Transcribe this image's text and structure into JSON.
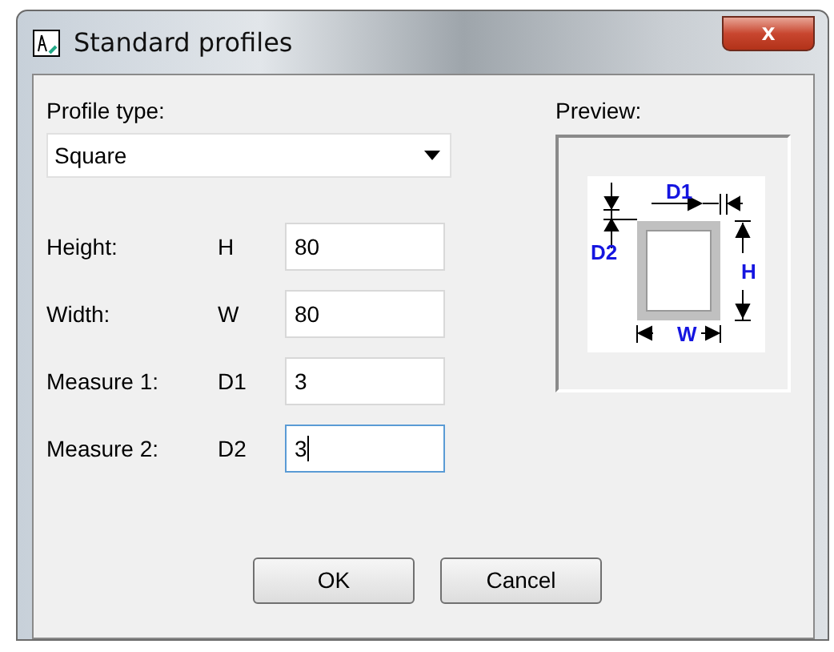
{
  "window": {
    "title": "Standard profiles",
    "close": "x"
  },
  "profile_type": {
    "label": "Profile type:",
    "value": "Square"
  },
  "fields": [
    {
      "label": "Height:",
      "symbol": "H",
      "value": "80",
      "focused": false
    },
    {
      "label": "Width:",
      "symbol": "W",
      "value": "80",
      "focused": false
    },
    {
      "label": "Measure 1:",
      "symbol": "D1",
      "value": "3",
      "focused": false
    },
    {
      "label": "Measure 2:",
      "symbol": "D2",
      "value": "3",
      "focused": true
    }
  ],
  "preview": {
    "label": "Preview:",
    "labels": [
      "D1",
      "D2",
      "H",
      "W"
    ]
  },
  "buttons": [
    "OK",
    "Cancel"
  ]
}
